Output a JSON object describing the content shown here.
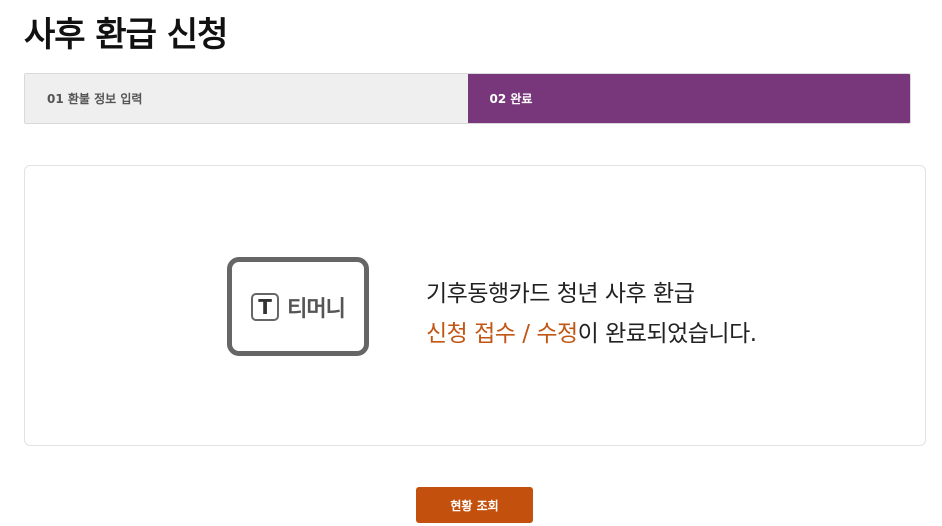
{
  "page": {
    "title": "사후 환급 신청"
  },
  "steps": [
    {
      "label": "01 환불 정보 입력",
      "active": false
    },
    {
      "label": "02 완료",
      "active": true
    }
  ],
  "logo": {
    "mark": "T",
    "text": "티머니",
    "icon": "tmoney-logo-icon"
  },
  "message": {
    "line1": "기후동행카드 청년 사후 환급",
    "highlight": "신청 접수 / 수정",
    "rest": "이 완료되었습니다."
  },
  "actions": {
    "status_label": "현황 조회"
  },
  "colors": {
    "accent_purple": "#78367b",
    "highlight_orange": "#c25614",
    "button_orange": "#c4500d"
  }
}
